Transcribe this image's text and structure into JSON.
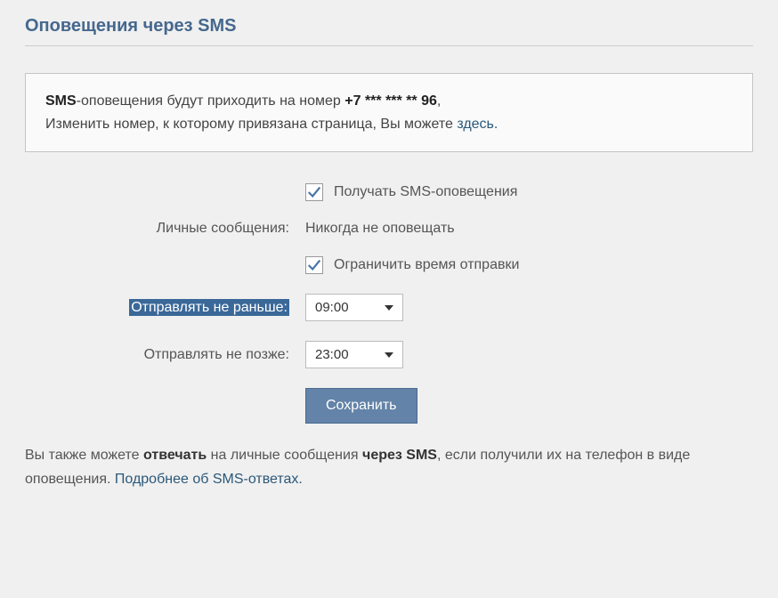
{
  "title": "Оповещения через SMS",
  "info": {
    "prefix": "SMS",
    "text1": "-оповещения будут приходить на номер ",
    "phone": "+7 *** *** ** 96",
    "text2": "Изменить номер, к которому привязана страница, Вы можете ",
    "link": "здесь."
  },
  "form": {
    "receive_sms_label": "Получать SMS-оповещения",
    "personal_messages_label": "Личные сообщения:",
    "personal_messages_value": "Никогда не оповещать",
    "limit_time_label": "Ограничить время отправки",
    "send_after_label": "Отправлять не раньше:",
    "send_after_value": "09:00",
    "send_before_label": "Отправлять не позже:",
    "send_before_value": "23:00",
    "save_button": "Сохранить"
  },
  "footer": {
    "text1": "Вы также можете ",
    "bold1": "отвечать",
    "text2": " на личные сообщения ",
    "bold2": "через SMS",
    "text3": ", если получили их на телефон в виде оповещения. ",
    "link": "Подробнее об SMS-ответах."
  }
}
